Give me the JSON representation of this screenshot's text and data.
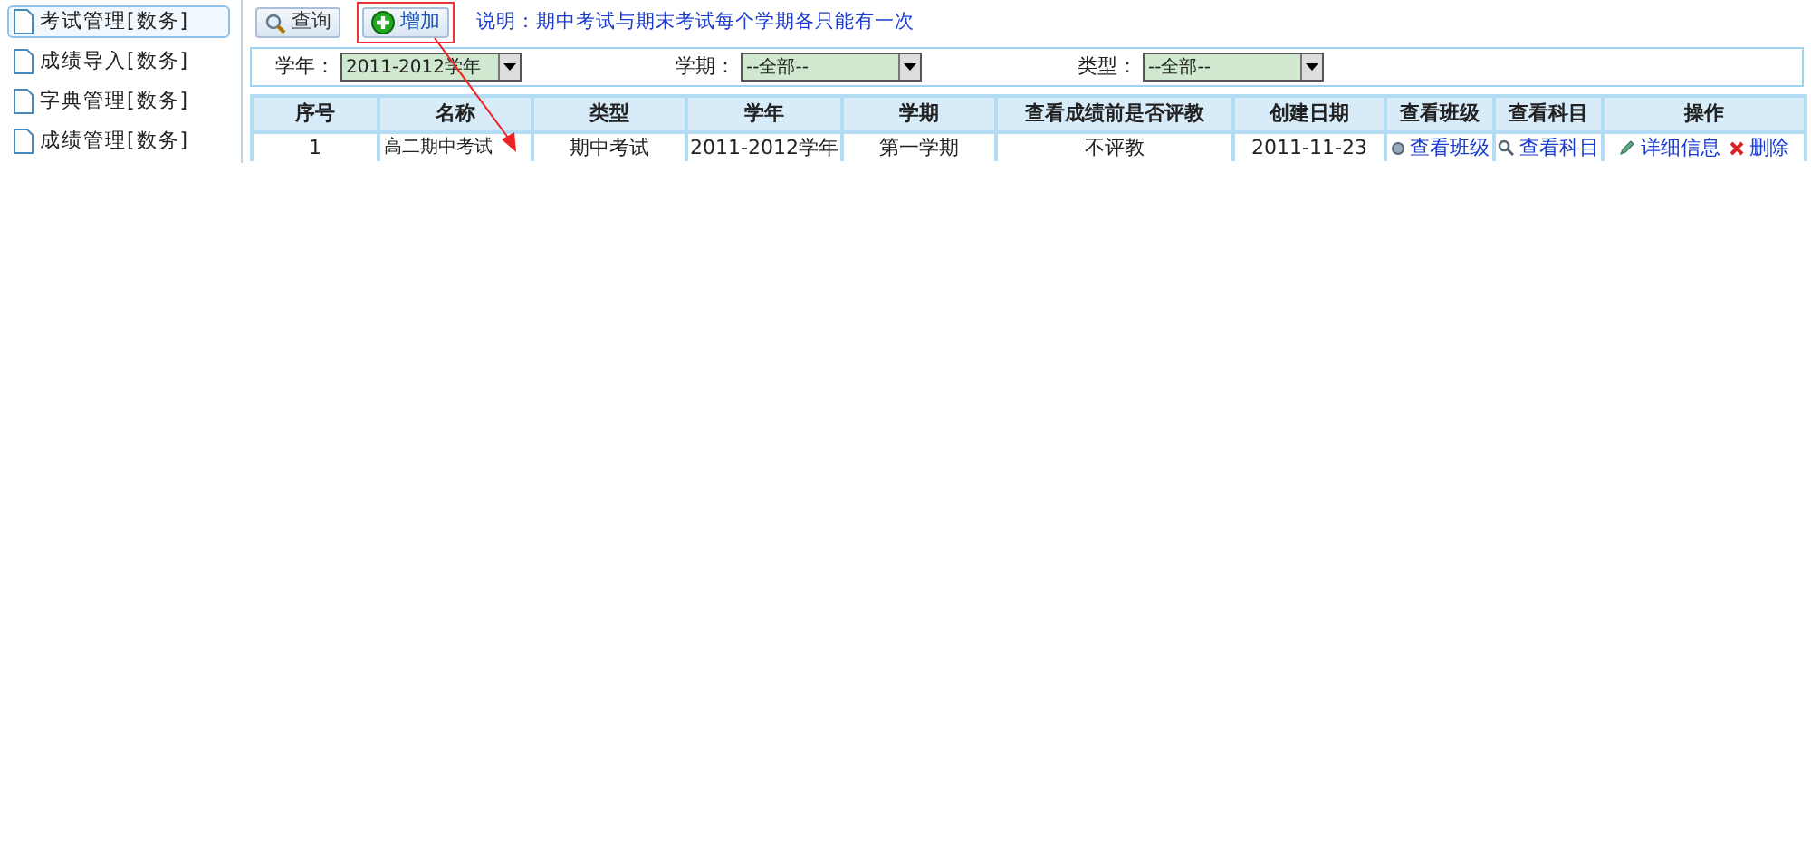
{
  "sidebar": {
    "items": [
      {
        "label": "考试管理[数务]",
        "selected": true
      },
      {
        "label": "成绩导入[数务]",
        "selected": false
      },
      {
        "label": "字典管理[数务]",
        "selected": false
      },
      {
        "label": "成绩管理[数务]",
        "selected": false
      }
    ]
  },
  "toolbar": {
    "buttons": [
      {
        "kind": "search",
        "label": "查询",
        "highlighted": false
      },
      {
        "kind": "add",
        "label": "增加",
        "highlighted": true
      }
    ],
    "note": "说明：期中考试与期末考试每个学期各只能有一次"
  },
  "filters": [
    {
      "label": "学年：",
      "value": "2011-2012学年"
    },
    {
      "label": "学期：",
      "value": "--全部--"
    },
    {
      "label": "类型：",
      "value": "--全部--"
    }
  ],
  "table": {
    "columns": [
      "序号",
      "名称",
      "类型",
      "学年",
      "学期",
      "查看成绩前是否评教",
      "创建日期",
      "查看班级",
      "查看科目",
      "操作"
    ],
    "rows": [
      [
        {
          "kind": "text",
          "text": "1"
        },
        {
          "kind": "text",
          "text": "高二期中考试"
        },
        {
          "kind": "text",
          "text": "期中考试"
        },
        {
          "kind": "text",
          "text": "2011-2012学年"
        },
        {
          "kind": "text",
          "text": "第一学期"
        },
        {
          "kind": "text",
          "text": "不评教"
        },
        {
          "kind": "text",
          "text": "2011-11-23"
        },
        {
          "kind": "links",
          "links": [
            {
              "kind": "view",
              "text": "查看班级"
            }
          ]
        },
        {
          "kind": "links",
          "links": [
            {
              "kind": "search",
              "text": "查看科目"
            }
          ]
        },
        {
          "kind": "links",
          "links": [
            {
              "kind": "edit",
              "text": "详细信息"
            },
            {
              "kind": "delete",
              "text": "删除"
            }
          ]
        }
      ]
    ]
  }
}
